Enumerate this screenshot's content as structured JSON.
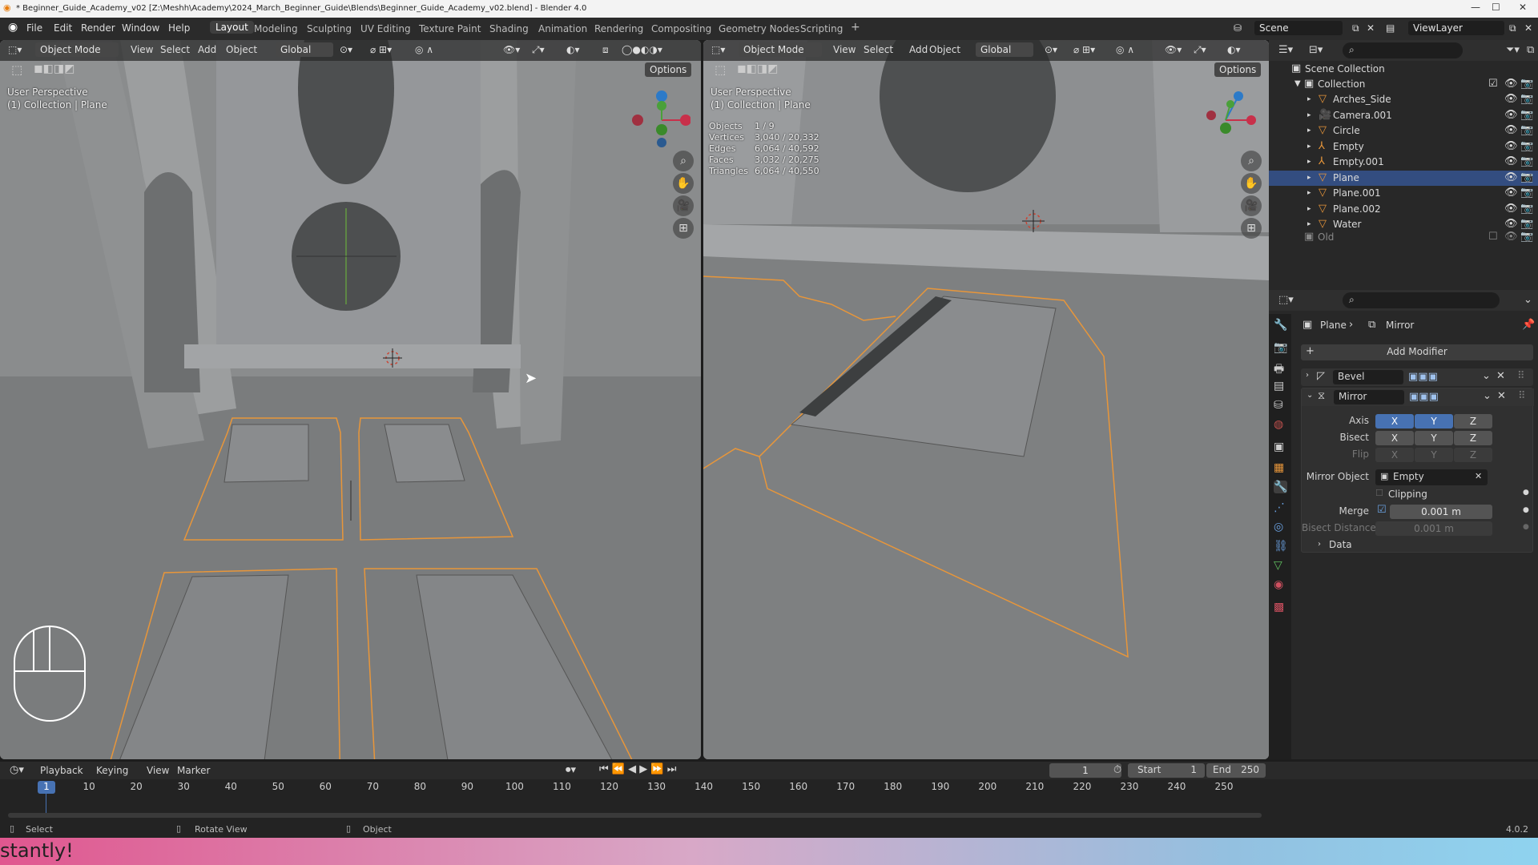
{
  "title_bar": {
    "text": "* Beginner_Guide_Academy_v02 [Z:\\Meshh\\Academy\\2024_March_Beginner_Guide\\Blends\\Beginner_Guide_Academy_v02.blend] - Blender 4.0"
  },
  "menu": {
    "items": [
      "File",
      "Edit",
      "Render",
      "Window",
      "Help"
    ]
  },
  "workspaces": [
    "Layout",
    "Modeling",
    "Sculpting",
    "UV Editing",
    "Texture Paint",
    "Shading",
    "Animation",
    "Rendering",
    "Compositing",
    "Geometry Nodes",
    "Scripting"
  ],
  "workspace_add": "+",
  "scene": {
    "label": "Scene",
    "view_layer": "ViewLayer"
  },
  "viewport_left": {
    "mode": "Object Mode",
    "menus": [
      "View",
      "Select",
      "Add",
      "Object"
    ],
    "transform": "Global",
    "options": "Options",
    "view_name": "User Perspective",
    "collection_label": "(1) Collection | Plane"
  },
  "viewport_right": {
    "mode": "Object Mode",
    "menus": [
      "View",
      "Select",
      "Add",
      "Object"
    ],
    "transform": "Global",
    "options": "Options",
    "view_name": "User Perspective",
    "collection_label": "(1) Collection | Plane",
    "stats": [
      {
        "label": "Objects",
        "value": "1 / 9"
      },
      {
        "label": "Vertices",
        "value": "3,040 / 20,332"
      },
      {
        "label": "Edges",
        "value": "6,064 / 40,592"
      },
      {
        "label": "Faces",
        "value": "3,032 / 20,275"
      },
      {
        "label": "Triangles",
        "value": "6,064 / 40,550"
      }
    ]
  },
  "outliner": {
    "root": "Scene Collection",
    "collection": "Collection",
    "items": [
      {
        "name": "Arches_Side",
        "icon": "mesh-icon",
        "selected": false
      },
      {
        "name": "Camera.001",
        "icon": "camera-icon",
        "selected": false
      },
      {
        "name": "Circle",
        "icon": "mesh-icon",
        "selected": false
      },
      {
        "name": "Empty",
        "icon": "empty-icon",
        "selected": false
      },
      {
        "name": "Empty.001",
        "icon": "empty-icon",
        "selected": false
      },
      {
        "name": "Plane",
        "icon": "mesh-icon",
        "selected": true
      },
      {
        "name": "Plane.001",
        "icon": "mesh-icon",
        "selected": false
      },
      {
        "name": "Plane.002",
        "icon": "mesh-icon",
        "selected": false
      },
      {
        "name": "Water",
        "icon": "mesh-icon",
        "selected": false
      }
    ],
    "old_collection": "Old"
  },
  "properties": {
    "breadcrumb_object": "Plane",
    "breadcrumb_modifier": "Mirror",
    "add_modifier": "Add Modifier",
    "modifiers": [
      {
        "name": "Bevel",
        "expanded": false
      },
      {
        "name": "Mirror",
        "expanded": true
      }
    ],
    "mirror": {
      "axis_label": "Axis",
      "bisect_label": "Bisect",
      "flip_label": "Flip",
      "axes": [
        "X",
        "Y",
        "Z"
      ],
      "axis_enabled": [
        true,
        true,
        false
      ],
      "mirror_object_label": "Mirror Object",
      "mirror_object_value": "Empty",
      "clipping_label": "Clipping",
      "merge_label": "Merge",
      "merge_value": "0.001 m",
      "bisect_distance_label": "Bisect Distance",
      "bisect_distance_value": "0.001 m",
      "data_label": "Data"
    }
  },
  "timeline": {
    "menus": [
      "Playback",
      "Keying",
      "View",
      "Marker"
    ],
    "current_frame": "1",
    "start_label": "Start",
    "start_value": "1",
    "end_label": "End",
    "end_value": "250",
    "ticks": [
      "1",
      "10",
      "20",
      "30",
      "40",
      "50",
      "60",
      "70",
      "80",
      "90",
      "100",
      "110",
      "120",
      "130",
      "140",
      "150",
      "160",
      "170",
      "180",
      "190",
      "200",
      "210",
      "220",
      "230",
      "240",
      "250"
    ]
  },
  "status_bar": {
    "select": "Select",
    "rotate": "Rotate View",
    "object": "Object",
    "version": "4.0.2"
  },
  "banner": {
    "text": "stantly!"
  },
  "colors": {
    "accent": "#4772b3",
    "selection_outline": "#e8963a",
    "viewport_bg": "#7d7f80",
    "panel_bg": "#282828"
  }
}
